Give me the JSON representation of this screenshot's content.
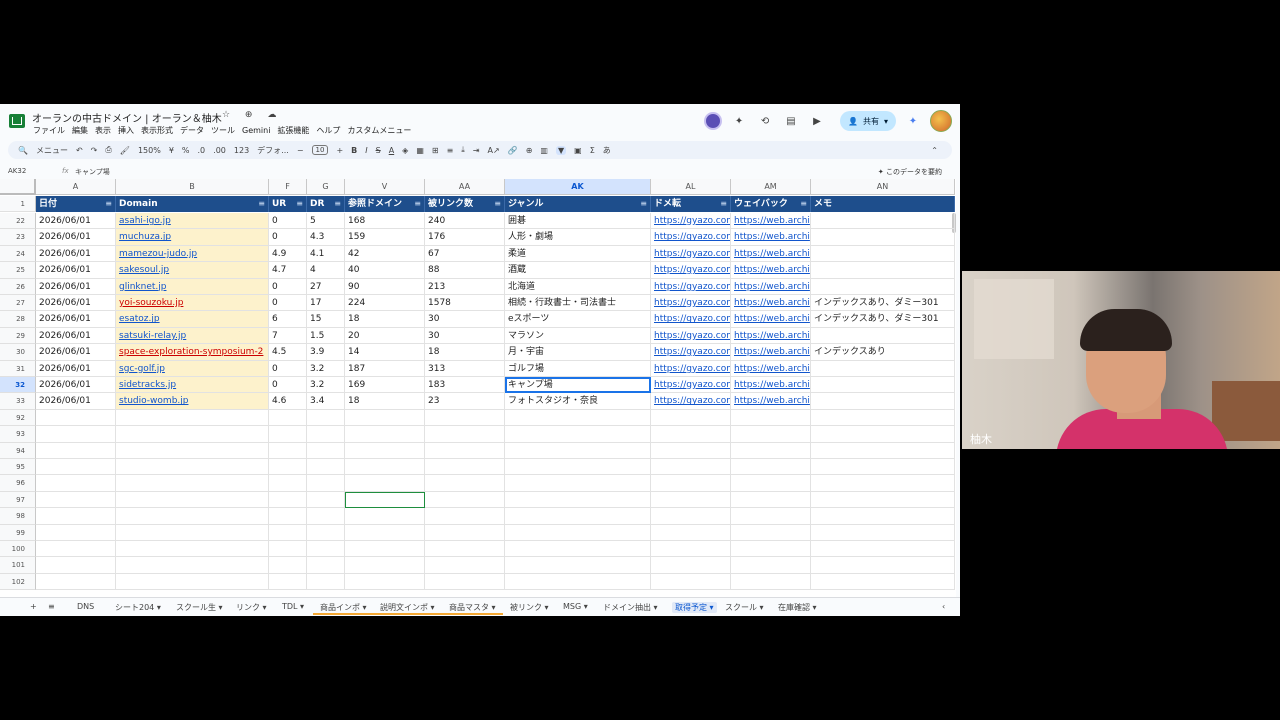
{
  "doc": {
    "title": "オーランの中古ドメイン | オーラン＆柚木",
    "title_icons": "☆ ⊕ ☁",
    "menus": [
      "ファイル",
      "編集",
      "表示",
      "挿入",
      "表示形式",
      "データ",
      "ツール",
      "Gemini",
      "拡張機能",
      "ヘルプ",
      "カスタムメニュー"
    ],
    "share_label": "共有"
  },
  "toolbar": {
    "menu_search": "メニュー",
    "zoom": "150%",
    "currency": "¥",
    "percent": "%",
    "dec_less": ".0",
    "dec_more": ".00",
    "number_fmt": "123",
    "font": "デフォ...",
    "font_size": "10",
    "bold": "B",
    "italic": "I",
    "strike": "S",
    "text_color": "A",
    "sum": "Σ",
    "ime": "あ"
  },
  "formula": {
    "namebox": "AK32",
    "fx": "fx",
    "value": "キャンプ場",
    "explore": "このデータを要約"
  },
  "columns": [
    {
      "letter": "A",
      "label": "日付"
    },
    {
      "letter": "B",
      "label": "Domain"
    },
    {
      "letter": "F",
      "label": "UR"
    },
    {
      "letter": "G",
      "label": "DR"
    },
    {
      "letter": "V",
      "label": "参照ドメイン"
    },
    {
      "letter": "AA",
      "label": "被リンク数"
    },
    {
      "letter": "AK",
      "label": "ジャンル"
    },
    {
      "letter": "AL",
      "label": "ドメ転"
    },
    {
      "letter": "AM",
      "label": "ウェイバック"
    },
    {
      "letter": "AN",
      "label": "メモ"
    }
  ],
  "header_row_num": "1",
  "rows": [
    {
      "num": "22",
      "date": "2026/06/01",
      "domain": "asahi-igo.jp",
      "ur": "0",
      "dr": "5",
      "ref": "168",
      "bl": "240",
      "genre": "囲碁",
      "al": "https://gyazo.com",
      "am": "https://web.archi",
      "memo": ""
    },
    {
      "num": "23",
      "date": "2026/06/01",
      "domain": "muchuza.jp",
      "ur": "0",
      "dr": "4.3",
      "ref": "159",
      "bl": "176",
      "genre": "人形・劇場",
      "al": "https://gyazo.com",
      "am": "https://web.archi",
      "memo": ""
    },
    {
      "num": "24",
      "date": "2026/06/01",
      "domain": "mamezou-judo.jp",
      "ur": "4.9",
      "dr": "4.1",
      "ref": "42",
      "bl": "67",
      "genre": "柔道",
      "al": "https://gyazo.com",
      "am": "https://web.archi",
      "memo": ""
    },
    {
      "num": "25",
      "date": "2026/06/01",
      "domain": "sakesoul.jp",
      "ur": "4.7",
      "dr": "4",
      "ref": "40",
      "bl": "88",
      "genre": "酒蔵",
      "al": "https://gyazo.com",
      "am": "https://web.archi",
      "memo": ""
    },
    {
      "num": "26",
      "date": "2026/06/01",
      "domain": "glinknet.jp",
      "ur": "0",
      "dr": "27",
      "ref": "90",
      "bl": "213",
      "genre": "北海道",
      "al": "https://gyazo.com",
      "am": "https://web.archi",
      "memo": ""
    },
    {
      "num": "27",
      "date": "2026/06/01",
      "domain": "yoi-souzoku.jp",
      "ur": "0",
      "dr": "17",
      "ref": "224",
      "bl": "1578",
      "genre": "相続・行政書士・司法書士",
      "al": "https://gyazo.com",
      "am": "https://web.archi",
      "memo": "インデックスあり、ダミー301"
    },
    {
      "num": "28",
      "date": "2026/06/01",
      "domain": "esatoz.jp",
      "ur": "6",
      "dr": "15",
      "ref": "18",
      "bl": "30",
      "genre": "eスポーツ",
      "al": "https://gyazo.com",
      "am": "https://web.archi",
      "memo": "インデックスあり、ダミー301"
    },
    {
      "num": "29",
      "date": "2026/06/01",
      "domain": "satsuki-relay.jp",
      "ur": "7",
      "dr": "1.5",
      "ref": "20",
      "bl": "30",
      "genre": "マラソン",
      "al": "https://gyazo.com",
      "am": "https://web.archi",
      "memo": ""
    },
    {
      "num": "30",
      "date": "2026/06/01",
      "domain": "space-exploration-symposium-2",
      "ur": "4.5",
      "dr": "3.9",
      "ref": "14",
      "bl": "18",
      "genre": "月・宇宙",
      "al": "https://gyazo.com",
      "am": "https://web.archi",
      "memo": "インデックスあり"
    },
    {
      "num": "31",
      "date": "2026/06/01",
      "domain": "sgc-golf.jp",
      "ur": "0",
      "dr": "3.2",
      "ref": "187",
      "bl": "313",
      "genre": "ゴルフ場",
      "al": "https://gyazo.com",
      "am": "https://web.archi",
      "memo": ""
    },
    {
      "num": "32",
      "date": "2026/06/01",
      "domain": "sidetracks.jp",
      "ur": "0",
      "dr": "3.2",
      "ref": "169",
      "bl": "183",
      "genre": "キャンプ場",
      "al": "https://gyazo.com",
      "am": "https://web.archi",
      "memo": ""
    },
    {
      "num": "33",
      "date": "2026/06/01",
      "domain": "studio-womb.jp",
      "ur": "4.6",
      "dr": "3.4",
      "ref": "18",
      "bl": "23",
      "genre": "フォトスタジオ・奈良",
      "al": "https://gyazo.com",
      "am": "https://web.archi",
      "memo": ""
    }
  ],
  "red_domains": [
    "yoi-souzoku.jp",
    "space-exploration-symposium-2"
  ],
  "empty_rows": [
    "92",
    "93",
    "94",
    "95",
    "96",
    "97",
    "98",
    "99",
    "100",
    "101",
    "102"
  ],
  "tabs": [
    "DNS",
    "シート204",
    "スクール生",
    "リンク",
    "TDL",
    "商品インポ",
    "説明文インポ",
    "商品マスタ",
    "被リンク",
    "MSG",
    "ドメイン抽出",
    "取得予定",
    "スクール",
    "在庫確認"
  ],
  "active_tab": "取得予定",
  "webcam": {
    "name": "柚木"
  },
  "colors": {
    "header_band": "#1e4e8c",
    "domain_fill": "#fdf2cc",
    "link": "#1155cc",
    "active": "#1a73e8"
  }
}
